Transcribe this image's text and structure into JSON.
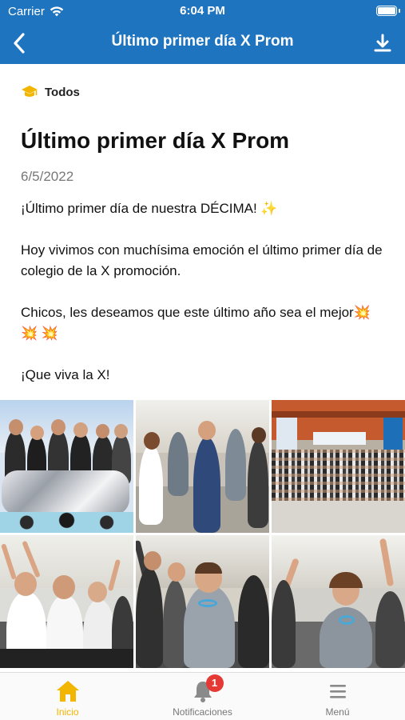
{
  "status_bar": {
    "carrier": "Carrier",
    "time": "6:04 PM",
    "icons": [
      "wifi-icon",
      "battery-icon"
    ]
  },
  "nav": {
    "title": "Último primer día X Prom",
    "back_icon": "chevron-left-icon",
    "download_icon": "download-icon"
  },
  "post": {
    "category": "Todos",
    "category_icon": "graduation-cap-icon",
    "title": "Último primer día X Prom",
    "date": "6/5/2022",
    "paragraphs": [
      "¡Último primer día de nuestra DÉCIMA! ✨",
      "Hoy vivimos con muchísima emoción el último primer día de colegio de la X promoción.",
      "Chicos, les deseamos que este último año sea el mejor💥 💥 💥",
      "¡Que viva la X!"
    ],
    "photo_count": 6
  },
  "tab_bar": {
    "items": [
      {
        "label": "Inicio",
        "icon": "home-icon",
        "active": true
      },
      {
        "label": "Notificaciones",
        "icon": "bell-icon",
        "badge": "1"
      },
      {
        "label": "Menú",
        "icon": "hamburger-menu-icon"
      }
    ]
  },
  "colors": {
    "header": "#1f74bf",
    "accent": "#f2b600",
    "badge": "#e53935"
  }
}
